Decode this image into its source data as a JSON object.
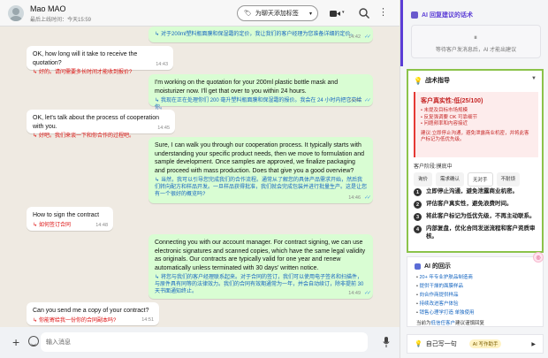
{
  "header": {
    "contact_name": "Mao MAO",
    "last_seen": "最后上线时间：今天15:59",
    "label_button": "为聊天添加标签"
  },
  "messages": [
    {
      "dir": "out",
      "orig": "",
      "trans": "对于200ml塑料瓶面膜和保湿霜的定价，我让我们的客户经理为您准备详细的定价。",
      "time": "14:42"
    },
    {
      "dir": "in",
      "orig": "OK, how long will it take to receive the quotation?",
      "trans": "好的。请问需要多长时间才能收到报价?",
      "time": "14:43"
    },
    {
      "dir": "out",
      "orig": "I'm working on the quotation for your 200ml plastic bottle mask and moisturizer now. I'll get that over to you within 24 hours.",
      "trans": "我现在正在处理你们 200 毫升塑料瓶面膜和保湿霜的报价。我会在 24 小时内把它交给你。",
      "time": "14:44"
    },
    {
      "dir": "in",
      "orig": "OK, let's talk about the process of cooperation with you.",
      "trans": "好吧。我们来谈一下和你合作的过程吧。",
      "time": "14:45"
    },
    {
      "dir": "out",
      "orig": "Sure, I can walk you through our cooperation process. It typically starts with understanding your specific product needs, then we move to formulation and sample development. Once samples are approved, we finalize packaging and proceed with mass production. Does that give you a good overview?",
      "trans": "当然，我可以引导您完成我们的合作流程。通常从了解您的具体产品需求开始，然后我们转向配方和样品开发。一旦样品获得批准，我们就会完成包装并进行批量生产。这是让您有一个很好的概览吗?",
      "time": "14:46"
    },
    {
      "dir": "in",
      "orig": "How to sign the contract",
      "trans": "如何签订合同",
      "time": "14:48"
    },
    {
      "dir": "out",
      "orig": "Connecting you with our account manager. For contract signing, we can use electronic signatures and scanned copies, which have the same legal validity as originals. Our contracts are typically valid for one year and renew automatically unless terminated with 30 days' written notice.",
      "trans": "将您与我们的客户经理联系起来。对于合同的签订，我们可以使用电子签名和扫描件，与原件具有同等的法律效力。我们的合同有效期通常为一年，并会自动续订，除非提前 30 天书面通知终止。",
      "time": "14:49"
    },
    {
      "dir": "in",
      "orig": "Can you send me a copy of your contract?",
      "trans": "你能寄给我一份你的合同副本吗?",
      "time": "14:51"
    }
  ],
  "composer": {
    "placeholder": "输入消息"
  },
  "panel": {
    "title": "AI 回复建议的话术",
    "waiting_text": "等待客户发消息后，AI 才能出建议",
    "strategy": {
      "title": "战术指导",
      "sincerity_title": "客户真实性:低(25/100)",
      "sincerity_points": [
        "未提及目标市场规模",
        "反复强调要 OK 可靠细节",
        "问题频率和内容接近"
      ],
      "advice": "建议:立即停止沟通，避免泄露商业机密，并将此客户标记为低优先级。",
      "stage_label": "客户阶段:摸底中",
      "stage_tags": [
        "询价",
        "需求确认",
        "无对手",
        "不耐烦"
      ],
      "steps": [
        "立即停止沟通，避免泄露商业机密。",
        "评估客户真实性，避免浪费时间。",
        "将此客户标记为低优先级，不再主动联系。",
        "内部复盘，优化合同发送流程和客户资质审核。"
      ]
    },
    "ai_suggestions": {
      "title": "AI 的回示",
      "items": [
        "20+ 年专业护肤品制造商",
        "提供干燥的面膜样品",
        "向合作商提供样品",
        "持续改进客户体验",
        "销售心理学打造 单独使用"
      ],
      "note_prefix": "当前为",
      "note_emphasis": "低信任客户",
      "note_suffix": "建议谨慎回复"
    },
    "write": {
      "title": "自己写一句",
      "assistant_tag": "AI 写作助手"
    }
  }
}
